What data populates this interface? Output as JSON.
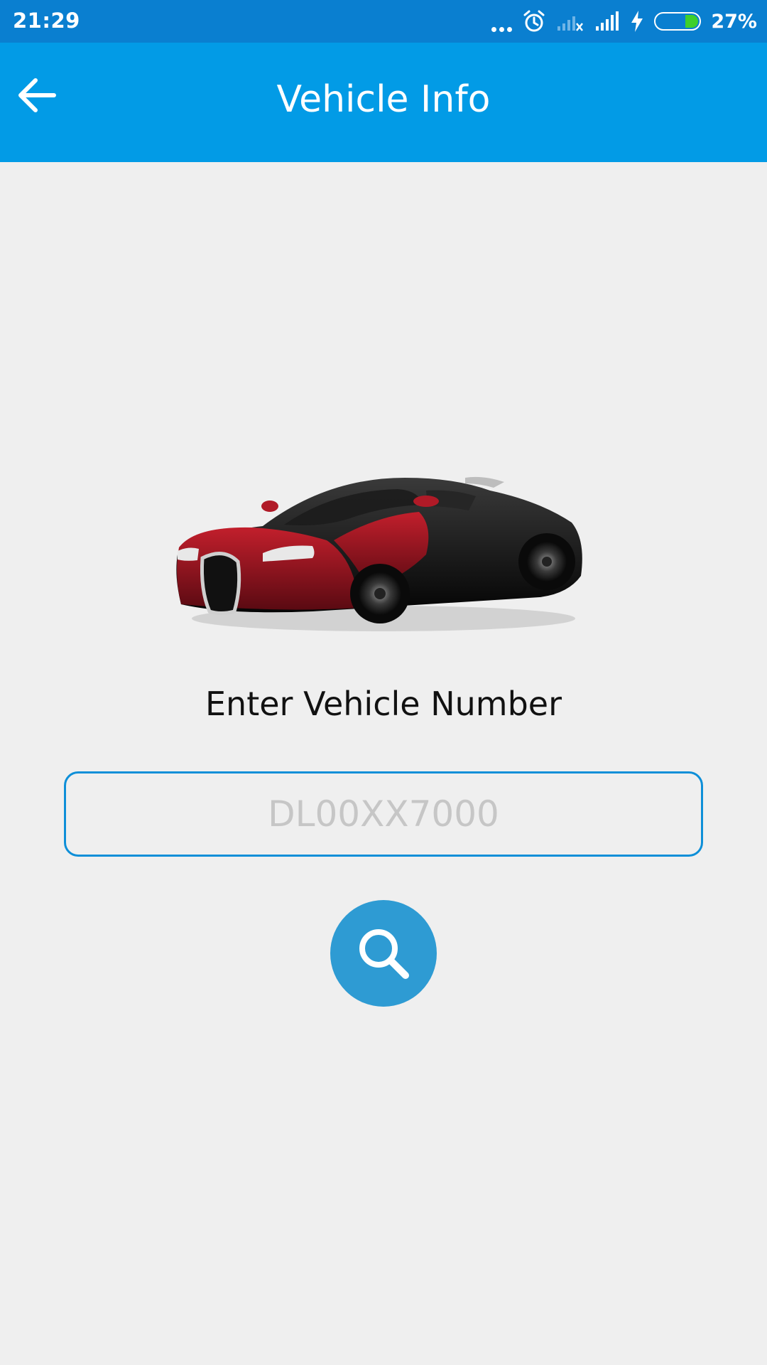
{
  "status_bar": {
    "time": "21:29",
    "battery_percent": "27%",
    "icons": [
      "more-dots-icon",
      "alarm-icon",
      "no-signal-icon",
      "signal-icon",
      "charging-icon",
      "battery-icon"
    ]
  },
  "app_bar": {
    "title": "Vehicle Info",
    "back_icon": "arrow-left-icon"
  },
  "main": {
    "image": "car-image",
    "prompt": "Enter Vehicle Number",
    "input_placeholder": "DL00XX7000",
    "input_value": "",
    "search_icon": "search-icon"
  },
  "colors": {
    "status_bar": "#0a7fd0",
    "app_bar": "#029be6",
    "background": "#efefef",
    "input_border": "#0e8fd8",
    "search_button": "#2e9bd3"
  }
}
